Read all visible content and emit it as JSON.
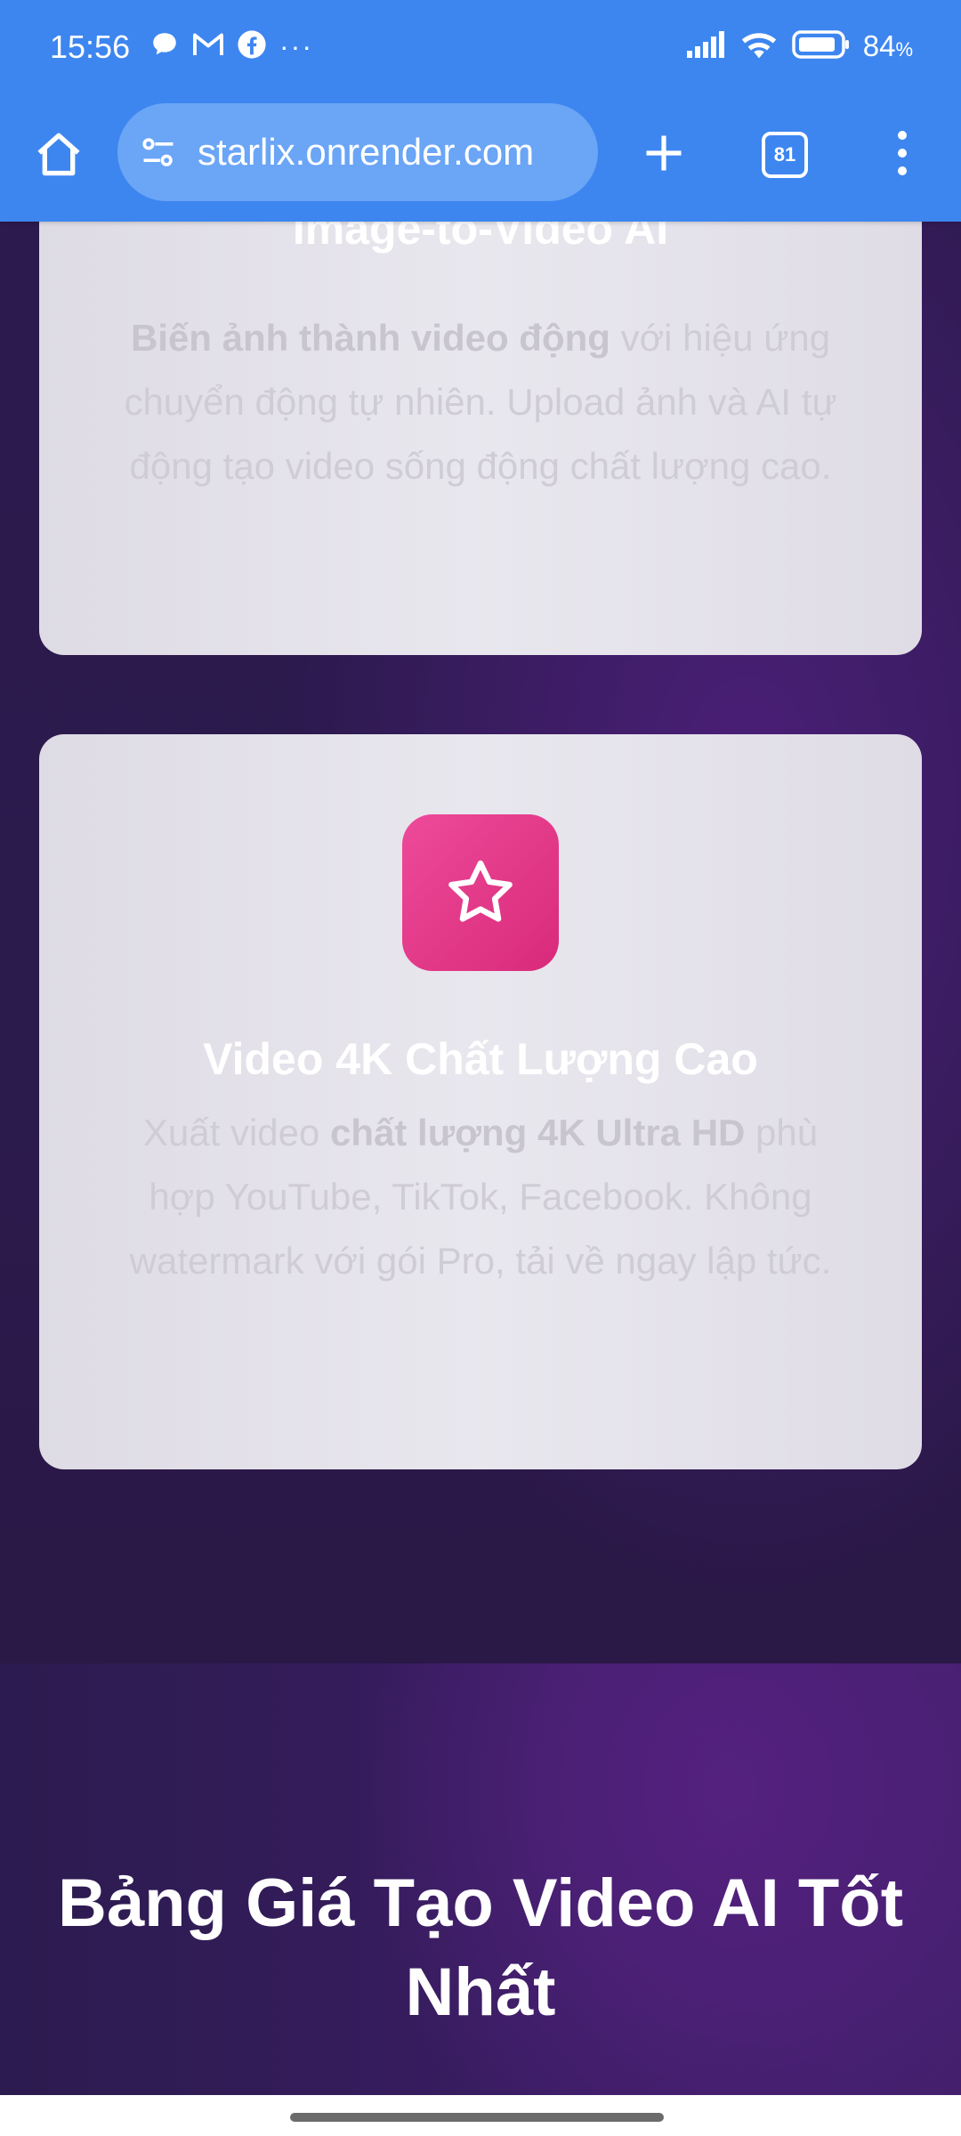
{
  "status_bar": {
    "time": "15:56",
    "more": "···",
    "battery": "84",
    "battery_unit": "%"
  },
  "browser": {
    "url": "starlix.onrender.com",
    "tab_count": "81"
  },
  "cards": [
    {
      "title": "Image-to-Video AI",
      "desc_bold": "Biến ảnh thành video động",
      "desc_rest": " với hiệu ứng chuyển động tự nhiên. Upload ảnh và AI tự động tạo video sống động chất lượng cao."
    },
    {
      "icon": "star-icon",
      "title": "Video 4K Chất Lượng Cao",
      "desc_pre": "Xuất video ",
      "desc_bold": "chất lượng 4K Ultra HD",
      "desc_rest": " phù hợp YouTube, TikTok, Facebook. Không watermark với gói Pro, tải về ngay lập tức."
    }
  ],
  "pricing": {
    "title": "Bảng Giá Tạo Video AI Tốt Nhất"
  },
  "colors": {
    "toolbar": "#3d86f0",
    "url_pill": "#6aa5f6",
    "icon_tile": "#e2357f",
    "page_bg": "#2a1a4a",
    "card_bg": "#e4e2ea"
  }
}
